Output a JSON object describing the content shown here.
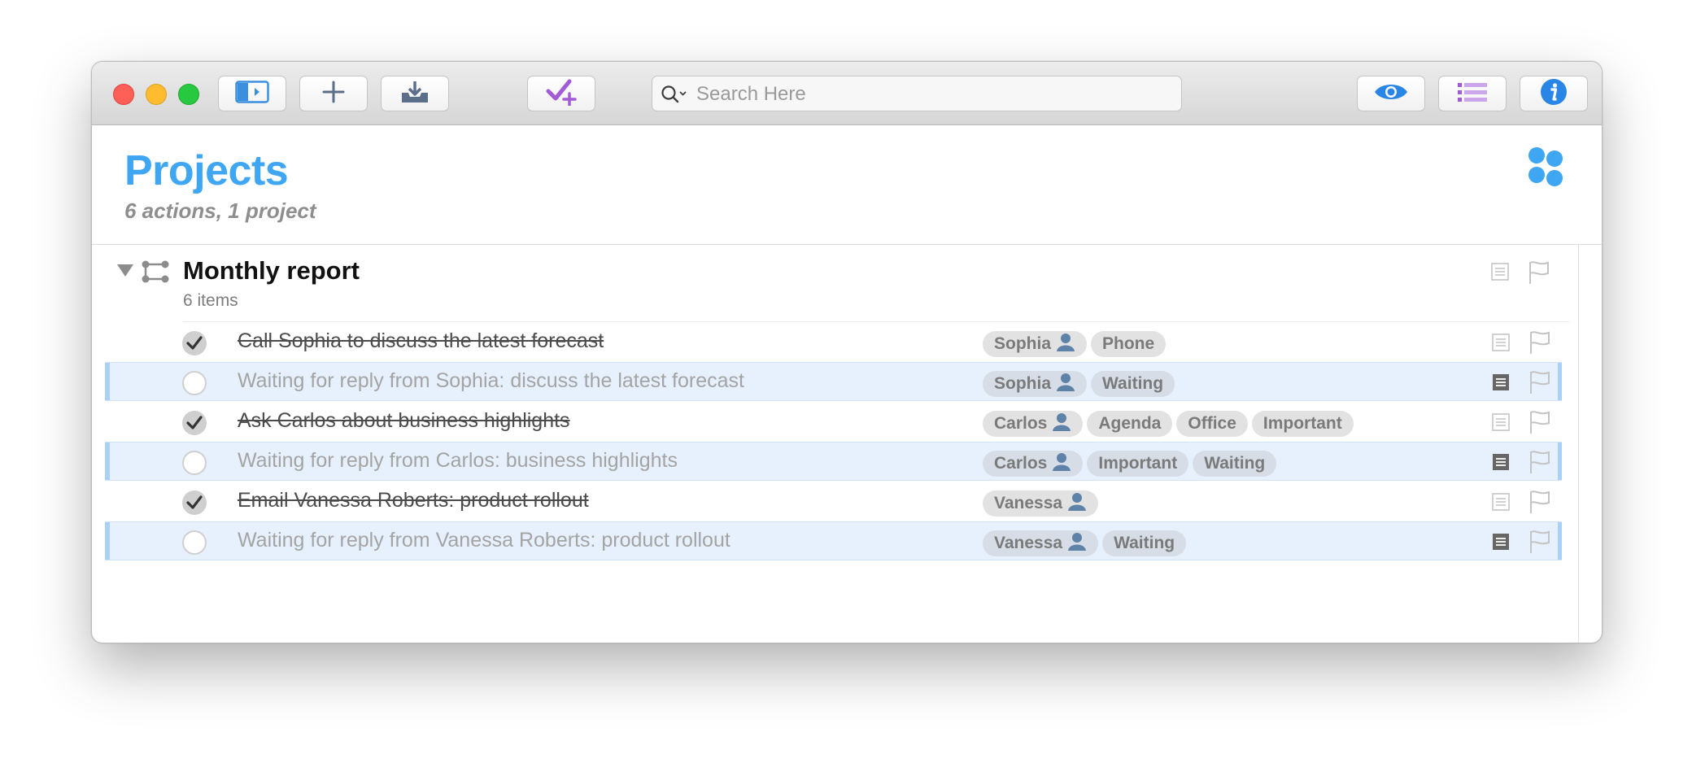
{
  "toolbar": {
    "sidebar_icon": "sidebar-toggle-icon",
    "add_icon": "plus-icon",
    "inbox_icon": "inbox-download-icon",
    "quick_entry_icon": "check-plus-icon",
    "view_icon": "eye-icon",
    "outline_icon": "list-icon",
    "inspector_icon": "info-icon"
  },
  "search": {
    "placeholder": "Search Here",
    "value": ""
  },
  "header": {
    "title": "Projects",
    "subtitle": "6 actions, 1 project",
    "perspective_icon": "projects-perspective-icon",
    "title_color": "#3ea6f2"
  },
  "project": {
    "title": "Monthly report",
    "count": "6 items",
    "rows": [
      {
        "title": "Call Sophia to discuss the latest forecast",
        "status": "done",
        "tags": [
          {
            "label": "Sophia",
            "person": true
          },
          {
            "label": "Phone",
            "person": false
          }
        ]
      },
      {
        "title": "Waiting for reply from Sophia: discuss the latest forecast",
        "status": "waiting",
        "tags": [
          {
            "label": "Sophia",
            "person": true
          },
          {
            "label": "Waiting",
            "person": false
          }
        ]
      },
      {
        "title": "Ask Carlos about business highlights",
        "status": "done",
        "tags": [
          {
            "label": "Carlos",
            "person": true
          },
          {
            "label": "Agenda",
            "person": false
          },
          {
            "label": "Office",
            "person": false
          },
          {
            "label": "Important",
            "person": false
          }
        ]
      },
      {
        "title": "Waiting for reply from Carlos: business highlights",
        "status": "waiting",
        "tags": [
          {
            "label": "Carlos",
            "person": true
          },
          {
            "label": "Important",
            "person": false
          },
          {
            "label": "Waiting",
            "person": false
          }
        ]
      },
      {
        "title": "Email Vanessa Roberts: product rollout",
        "status": "done",
        "tags": [
          {
            "label": "Vanessa",
            "person": true
          }
        ]
      },
      {
        "title": "Waiting for reply from Vanessa Roberts: product rollout",
        "status": "waiting",
        "tags": [
          {
            "label": "Vanessa",
            "person": true
          },
          {
            "label": "Waiting",
            "person": false
          }
        ]
      }
    ]
  },
  "colors": {
    "accent": "#3ea6f2",
    "waiting_row": "#e6f1fd",
    "quick_entry": "#a25ad6"
  }
}
